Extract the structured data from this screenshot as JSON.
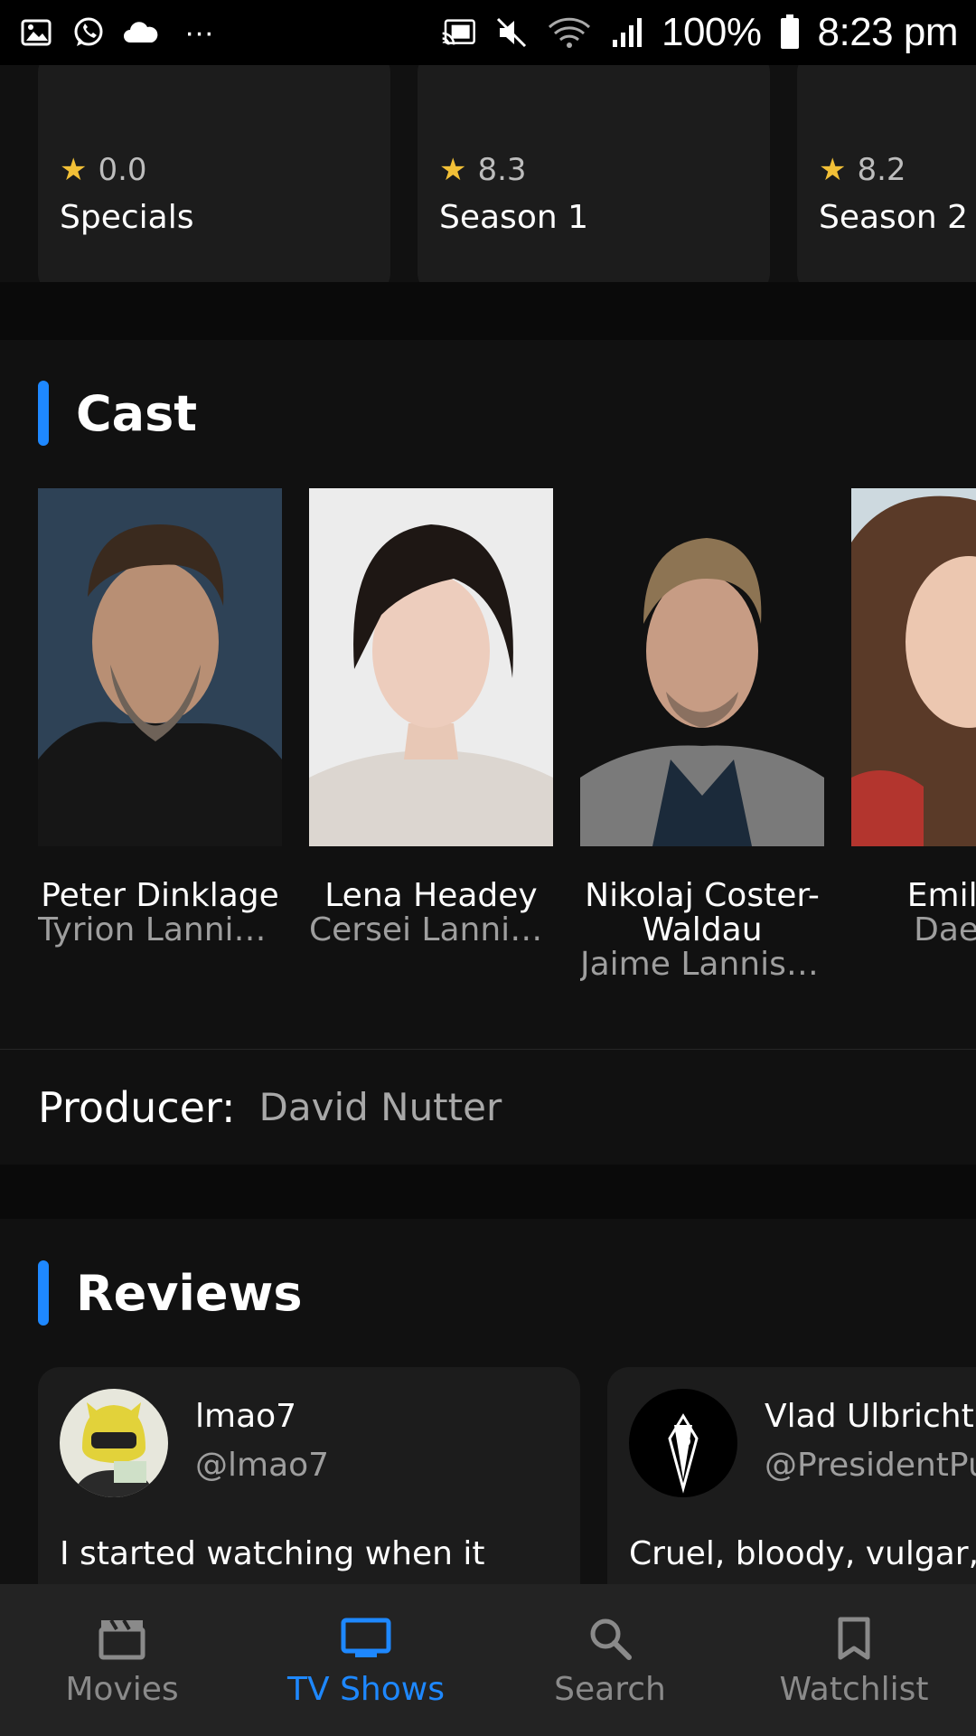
{
  "status_bar": {
    "battery": "100%",
    "time": "8:23 pm",
    "overflow": "···"
  },
  "seasons": [
    {
      "rating": "0.0",
      "title": "Specials"
    },
    {
      "rating": "8.3",
      "title": "Season 1"
    },
    {
      "rating": "8.2",
      "title": "Season 2"
    }
  ],
  "cast_section": {
    "title": "Cast",
    "members": [
      {
        "name": "Peter Dinklage",
        "role": "Tyrion Lannist..."
      },
      {
        "name": "Lena Headey",
        "role": "Cersei Lannis..."
      },
      {
        "name": "Nikolaj Coster-Waldau",
        "role": "Jaime Lannist..."
      },
      {
        "name": "Emilia C",
        "role": "Daener"
      }
    ]
  },
  "producer": {
    "label": "Producer:",
    "value": "David Nutter"
  },
  "reviews_section": {
    "title": "Reviews",
    "reviews": [
      {
        "name": "lmao7",
        "handle": "@lmao7",
        "text": "I started watching when it"
      },
      {
        "name": "Vlad Ulbricht",
        "handle": "@PresidentPu",
        "text": "Cruel, bloody, vulgar,"
      }
    ]
  },
  "bottom_nav": {
    "items": [
      {
        "label": "Movies",
        "icon": "clapperboard-icon",
        "active": false
      },
      {
        "label": "TV Shows",
        "icon": "tv-icon",
        "active": true
      },
      {
        "label": "Search",
        "icon": "search-icon",
        "active": false
      },
      {
        "label": "Watchlist",
        "icon": "bookmark-icon",
        "active": false
      }
    ]
  },
  "colors": {
    "accent": "#1e88ff",
    "star": "#f2c037",
    "background": "#111111",
    "card": "#1c1c1c"
  }
}
